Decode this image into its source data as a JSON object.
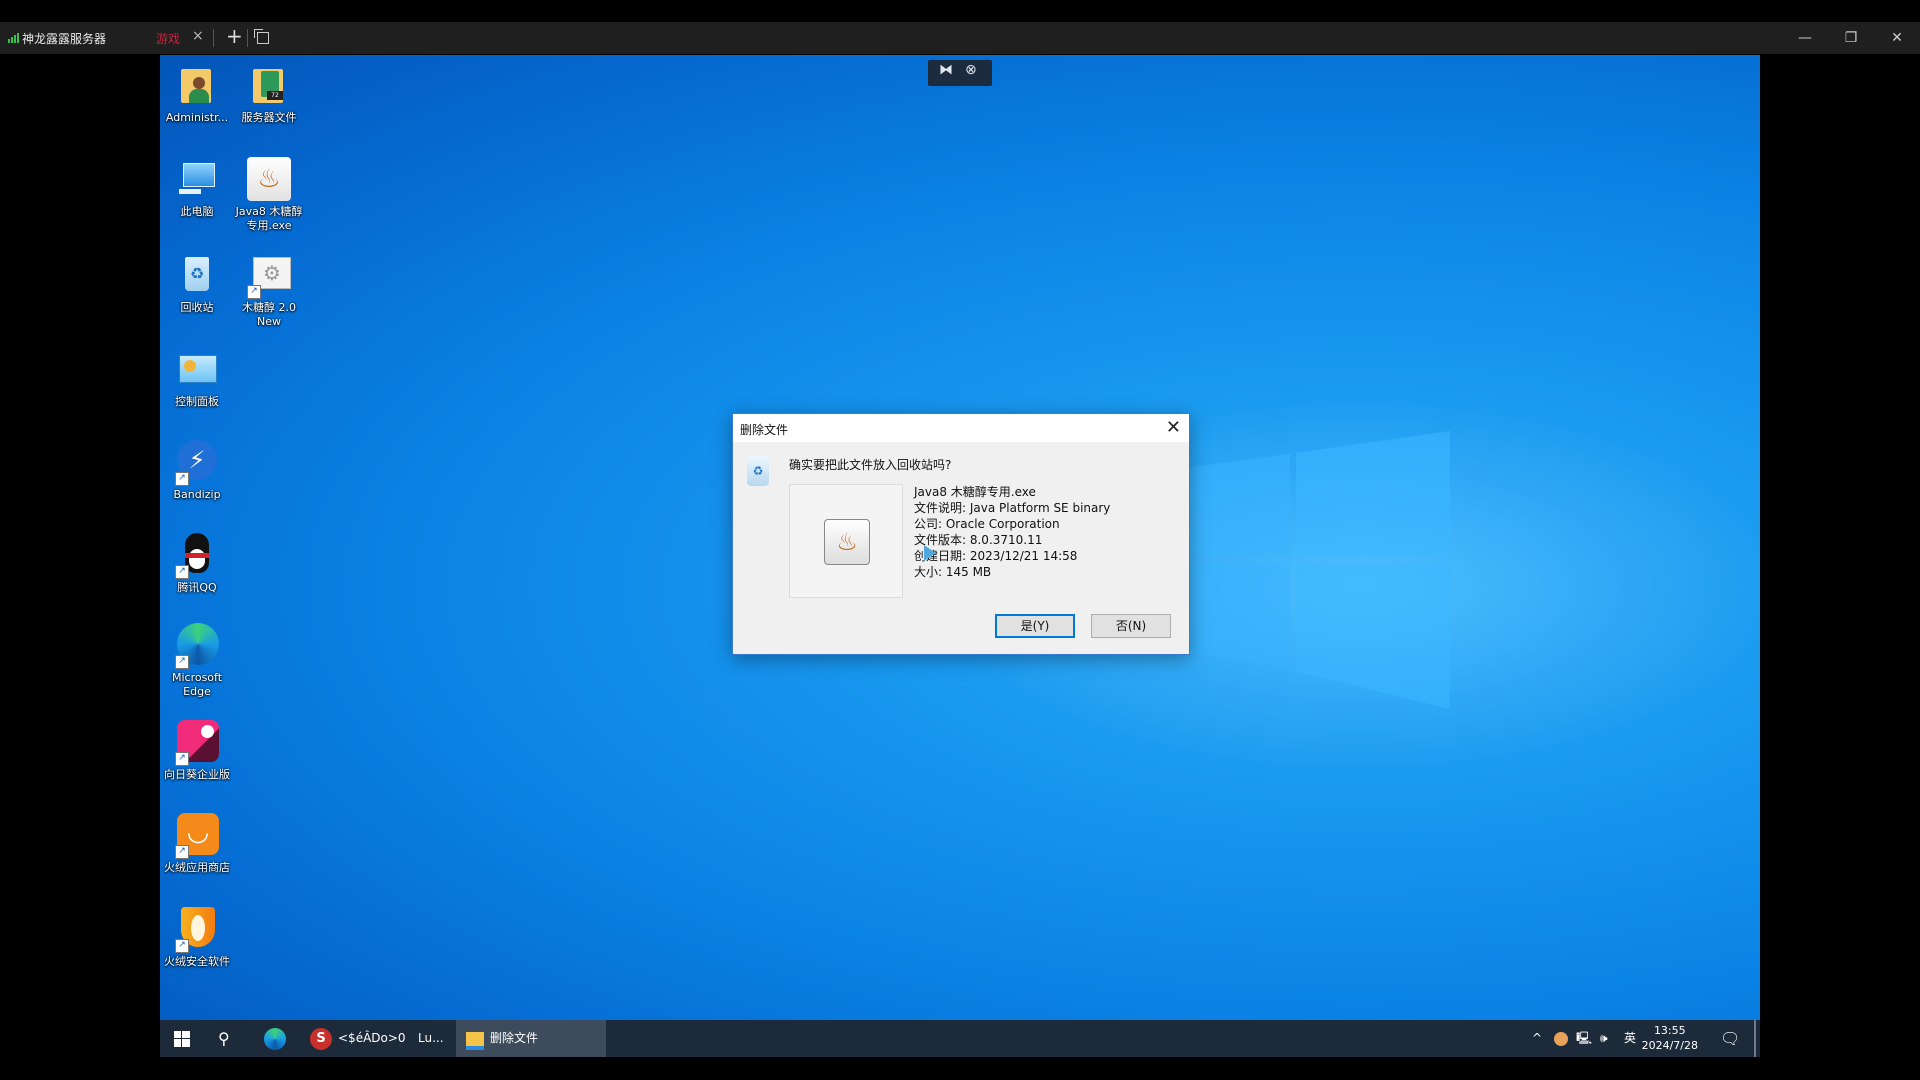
{
  "app": {
    "title": "神龙露露服务器",
    "tab_label": "游戏",
    "tab_close": "×",
    "new_tab": "+",
    "window_controls": {
      "minimize": "—",
      "restore": "❐",
      "close": "✕"
    }
  },
  "remote_toolbar": {
    "collapse_icon": "⧓",
    "disconnect_icon": "⊗"
  },
  "desktop_icons": [
    {
      "label": "Administr...",
      "icon": "user-folder-icon",
      "shortcut": false
    },
    {
      "label": "服务器文件",
      "icon": "server-folder-icon",
      "shortcut": false
    },
    {
      "label": "此电脑",
      "icon": "this-pc-icon",
      "shortcut": false
    },
    {
      "label": "Java8 木糖醇专用.exe",
      "icon": "java-icon",
      "shortcut": false
    },
    {
      "label": "回收站",
      "icon": "recycle-bin-icon",
      "shortcut": false
    },
    {
      "label": "木糖醇 2.0 New",
      "icon": "gears-app-icon",
      "shortcut": true
    },
    {
      "label": "控制面板",
      "icon": "control-panel-icon",
      "shortcut": false
    },
    {
      "label": "Bandizip",
      "icon": "bandizip-icon",
      "shortcut": true
    },
    {
      "label": "腾讯QQ",
      "icon": "qq-icon",
      "shortcut": true
    },
    {
      "label": "Microsoft Edge",
      "icon": "edge-icon",
      "shortcut": true
    },
    {
      "label": "向日葵企业版",
      "icon": "sunlogin-icon",
      "shortcut": true
    },
    {
      "label": "火绒应用商店",
      "icon": "huorong-store-icon",
      "shortcut": true
    },
    {
      "label": "火绒安全软件",
      "icon": "huorong-security-icon",
      "shortcut": true
    }
  ],
  "dialog": {
    "title": "删除文件",
    "question": "确实要把此文件放入回收站吗?",
    "file_name": "Java8 木糖醇专用.exe",
    "description": "文件说明: Java Platform SE binary",
    "company": "公司: Oracle Corporation",
    "version": "文件版本: 8.0.3710.11",
    "created": "创建日期: 2023/12/21 14:58",
    "size": "大小: 145 MB",
    "yes_button": "是(Y)",
    "no_button": "否(N)"
  },
  "taskbar": {
    "items": [
      {
        "label": "",
        "icon": "start-icon"
      },
      {
        "label": "",
        "icon": "search-icon"
      },
      {
        "label": "",
        "icon": "edge-icon"
      },
      {
        "label": "<$éÂDo>0",
        "icon": "s-app-icon"
      },
      {
        "label": "Lu...",
        "icon": ""
      },
      {
        "label": "删除文件",
        "icon": "file-explorer-icon"
      }
    ],
    "tray": {
      "ime": "英",
      "time": "13:55",
      "date": "2024/7/28"
    }
  },
  "colors": {
    "accent": "#0078d7",
    "tab_red": "#c4263f",
    "desktop_blue": "#0a84e6"
  }
}
